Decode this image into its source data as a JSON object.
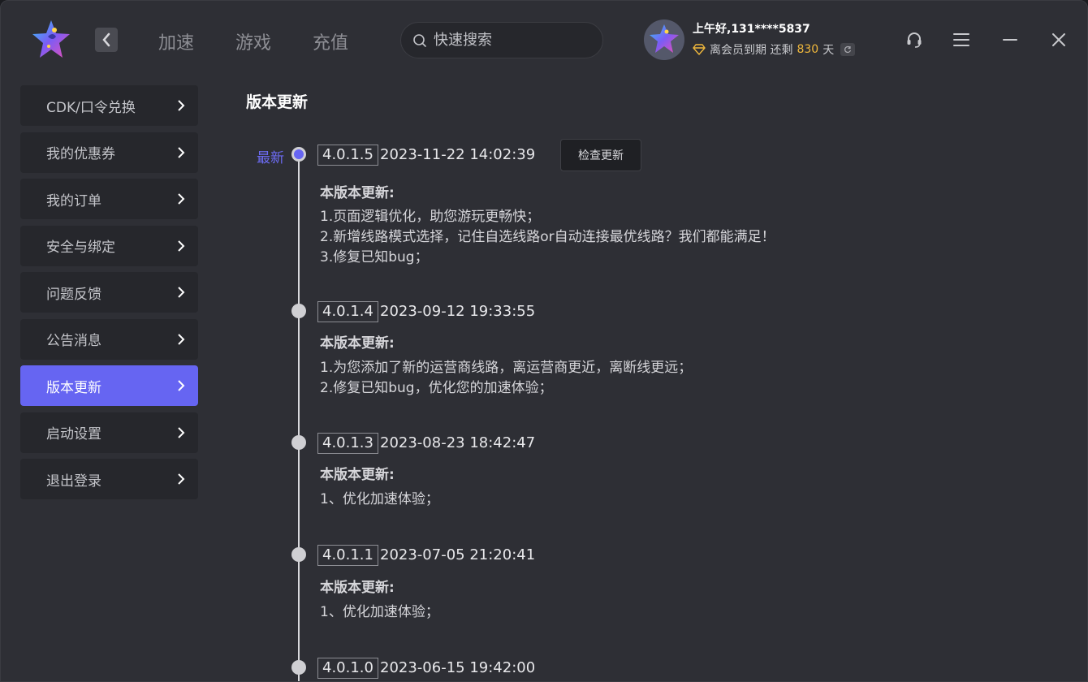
{
  "header": {
    "nav_tabs": [
      "加速",
      "游戏",
      "充值"
    ],
    "search_placeholder": "快速搜索",
    "greeting": "上午好,131****5837",
    "member_prefix": "离会员到期 还剩",
    "member_days": "830",
    "member_suffix": "天"
  },
  "sidebar": {
    "items": [
      {
        "label": "CDK/口令兑换"
      },
      {
        "label": "我的优惠券"
      },
      {
        "label": "我的订单"
      },
      {
        "label": "安全与绑定"
      },
      {
        "label": "问题反馈"
      },
      {
        "label": "公告消息"
      },
      {
        "label": "版本更新",
        "active": true
      },
      {
        "label": "启动设置"
      },
      {
        "label": "退出登录"
      }
    ]
  },
  "main": {
    "title": "版本更新",
    "latest_label": "最新",
    "check_button": "检查更新",
    "notes_title": "本版本更新:",
    "versions": [
      {
        "version": "4.0.1.5",
        "date": "2023-11-22 14:02:39",
        "notes": [
          "1.页面逻辑优化，助您游玩更畅快；",
          "2.新增线路模式选择，记住自选线路or自动连接最优线路？我们都能满足！",
          "3.修复已知bug；"
        ]
      },
      {
        "version": "4.0.1.4",
        "date": "2023-09-12 19:33:55",
        "notes": [
          "1.为您添加了新的运营商线路，离运营商更近，离断线更远；",
          "2.修复已知bug，优化您的加速体验；"
        ]
      },
      {
        "version": "4.0.1.3",
        "date": "2023-08-23 18:42:47",
        "notes": [
          "1、优化加速体验；"
        ]
      },
      {
        "version": "4.0.1.1",
        "date": "2023-07-05 21:20:41",
        "notes": [
          "1、优化加速体验；"
        ]
      },
      {
        "version": "4.0.1.0",
        "date": "2023-06-15 19:42:00",
        "notes": []
      }
    ]
  },
  "colors": {
    "accent": "#6665f2",
    "background": "#2e2f35",
    "sidebar_item": "#26272c",
    "gold": "#f0b83c"
  },
  "icons": [
    "app-logo-icon",
    "back-arrow-icon",
    "search-icon",
    "vip-diamond-icon",
    "refresh-icon",
    "headset-icon",
    "menu-icon",
    "minimize-icon",
    "close-icon",
    "chevron-right-icon"
  ]
}
